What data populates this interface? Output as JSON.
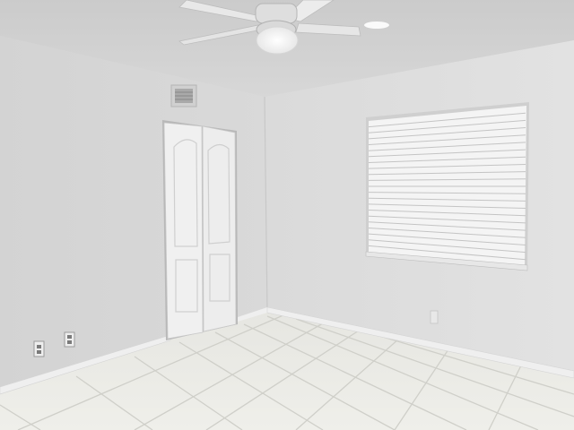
{
  "scene": {
    "description_label": "",
    "colors": {
      "ceiling": "#cfcfcf",
      "left_wall": "#d6d6d6",
      "right_wall": "#dedede",
      "floor_tile": "#e9e9e4",
      "grout": "#cbcbc5",
      "door": "#f1f1f1",
      "blind": "#f3f3f3",
      "baseboard": "#f0f0f0",
      "vent": "#bdbdbd",
      "fan": "#e6e6e6"
    },
    "icons": [
      "ceiling-fan-icon",
      "air-vent-icon",
      "outlet-icon",
      "window-blind-icon",
      "closet-door-icon"
    ]
  }
}
